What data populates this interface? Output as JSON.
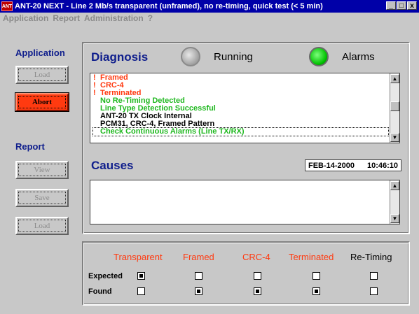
{
  "window": {
    "title": "ANT-20 NEXT - Line 2 Mb/s transparent (unframed), no re-timing, quick test (< 5 min)",
    "app_icon_text": "ANT",
    "controls": [
      "_",
      "□",
      "x"
    ]
  },
  "menu": [
    "Application",
    "Report",
    "Administration",
    "?"
  ],
  "sidebar": {
    "application_heading": "Application",
    "load_label": "Load",
    "abort_label": "Abort",
    "report_heading": "Report",
    "view_label": "View",
    "save_label": "Save",
    "report_load_label": "Load"
  },
  "diagnosis": {
    "title": "Diagnosis",
    "running_label": "Running",
    "alarms_label": "Alarms",
    "running_color": "#a8a8a8",
    "alarms_color": "#00c000",
    "messages": [
      {
        "mark": "!",
        "text": "Framed",
        "color": "#ff3a10"
      },
      {
        "mark": "!",
        "text": "CRC-4",
        "color": "#ff3a10"
      },
      {
        "mark": "!",
        "text": "Terminated",
        "color": "#ff3a10"
      },
      {
        "mark": "",
        "text": "No Re-Timing Detected",
        "color": "#1fb81f"
      },
      {
        "mark": "",
        "text": "Line Type Detection Successful",
        "color": "#1fb81f"
      },
      {
        "mark": "",
        "text": "ANT-20 TX Clock Internal",
        "color": "#000000"
      },
      {
        "mark": "",
        "text": "PCM31, CRC-4, Framed Pattern",
        "color": "#000000"
      },
      {
        "mark": "",
        "text": "Check Continuous Alarms (Line TX/RX)",
        "color": "#1fb81f"
      }
    ]
  },
  "causes": {
    "title": "Causes",
    "date": "FEB-14-2000",
    "time": "10:46:10"
  },
  "results": {
    "columns": [
      {
        "label": "Transparent",
        "color": "#ff3a10",
        "expected": true,
        "found": false
      },
      {
        "label": "Framed",
        "color": "#ff3a10",
        "expected": false,
        "found": true
      },
      {
        "label": "CRC-4",
        "color": "#ff3a10",
        "expected": false,
        "found": true
      },
      {
        "label": "Terminated",
        "color": "#ff3a10",
        "expected": false,
        "found": true
      },
      {
        "label": "Re-Timing",
        "color": "#000000",
        "expected": false,
        "found": false
      }
    ],
    "expected_label": "Expected",
    "found_label": "Found"
  }
}
